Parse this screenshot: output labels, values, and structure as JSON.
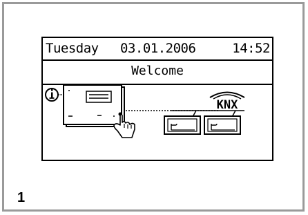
{
  "display": {
    "day": "Tuesday",
    "date": "03.01.2006",
    "time": "14:52",
    "welcome": "Welcome"
  },
  "diagram": {
    "info_icon": "info-circle-icon",
    "device_icon": "control-panel-icon",
    "hand_icon": "pointing-hand-icon",
    "bus_label": "KNX",
    "module_icons": [
      "bus-module-icon",
      "bus-module-icon"
    ]
  },
  "figure": {
    "number": "1"
  },
  "colors": {
    "border": "#9a9a9a",
    "ink": "#000000",
    "background": "#ffffff"
  }
}
